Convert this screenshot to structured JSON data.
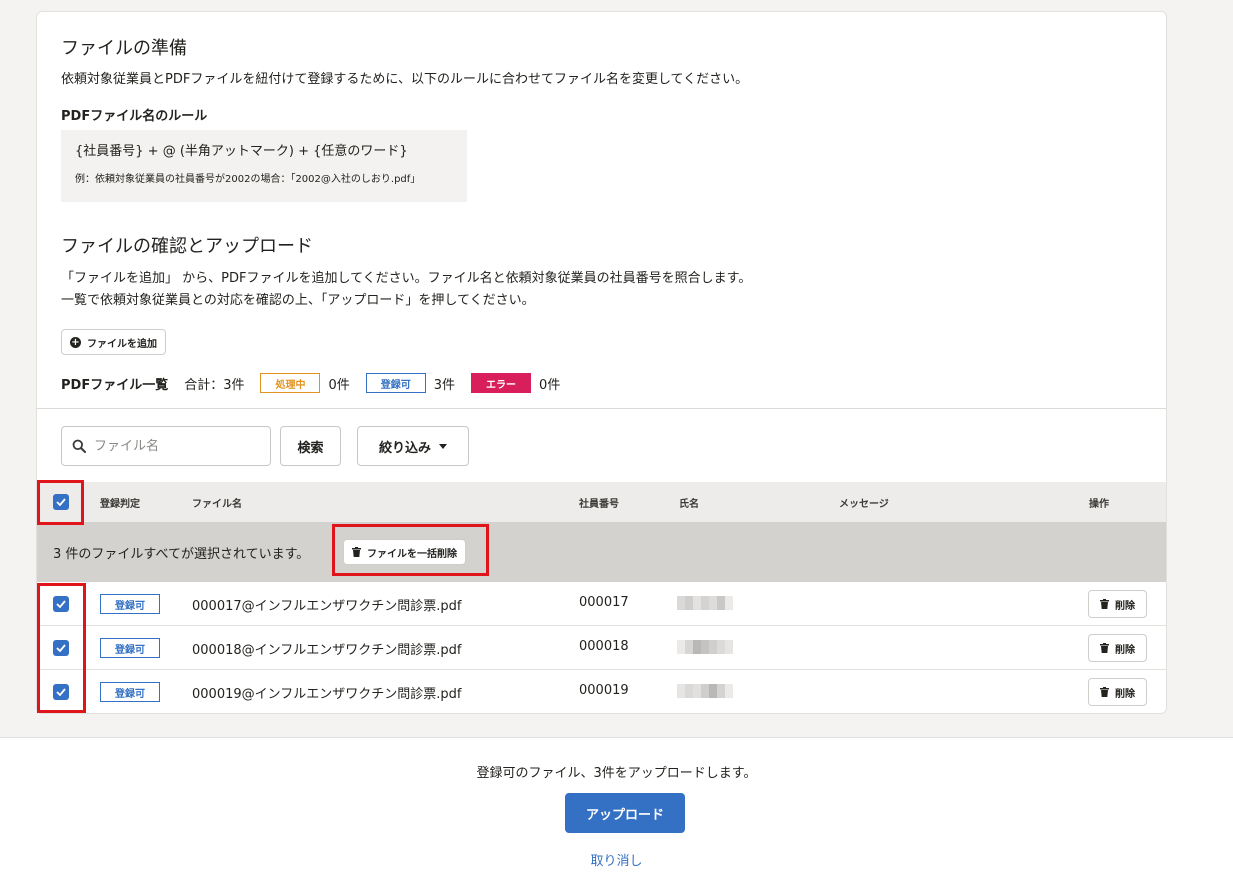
{
  "prep": {
    "title": "ファイルの準備",
    "description": "依頼対象従業員とPDFファイルを紐付けて登録するために、以下のルールに合わせてファイル名を変更してください。",
    "rule_title": "PDFファイル名のルール",
    "rule_formula": "{社員番号} + @ (半角アットマーク) + {任意のワード}",
    "rule_example": "例：依頼対象従業員の社員番号が2002の場合：「2002@入社のしおり.pdf」"
  },
  "confirm": {
    "title": "ファイルの確認とアップロード",
    "line1": "「ファイルを追加」 から、PDFファイルを追加してください。ファイル名と依頼対象従業員の社員番号を照合します。",
    "line2": "一覧で依頼対象従業員との対応を確認の上、「アップロード」を押してください。",
    "add_button": "ファイルを追加"
  },
  "summary": {
    "title": "PDFファイル一覧",
    "total": "合計：3件",
    "processing_label": "処理中",
    "processing_count": "0件",
    "ok_label": "登録可",
    "ok_count": "3件",
    "error_label": "エラー",
    "error_count": "0件"
  },
  "filter": {
    "search_placeholder": "ファイル名",
    "search_button": "検索",
    "filter_button": "絞り込み"
  },
  "table": {
    "headers": {
      "status": "登録判定",
      "filename": "ファイル名",
      "employee_no": "社員番号",
      "name": "氏名",
      "message": "メッセージ",
      "actions": "操作"
    },
    "selection_message": "3 件のファイルすべてが選択されています。",
    "bulk_delete": "ファイルを一括削除",
    "rows": [
      {
        "status": "登録可",
        "filename": "000017@インフルエンザワクチン問診票.pdf",
        "employee_no": "000017",
        "delete": "削除"
      },
      {
        "status": "登録可",
        "filename": "000018@インフルエンザワクチン問診票.pdf",
        "employee_no": "000018",
        "delete": "削除"
      },
      {
        "status": "登録可",
        "filename": "000019@インフルエンザワクチン問診票.pdf",
        "employee_no": "000019",
        "delete": "削除"
      }
    ]
  },
  "footer": {
    "message": "登録可のファイル、3件をアップロードします。",
    "upload_button": "アップロード",
    "cancel_link": "取り消し"
  },
  "colors": {
    "primary": "#3471c4",
    "warning": "#e2931f",
    "error": "#d81e5b",
    "highlight_frame": "#e0141b"
  }
}
